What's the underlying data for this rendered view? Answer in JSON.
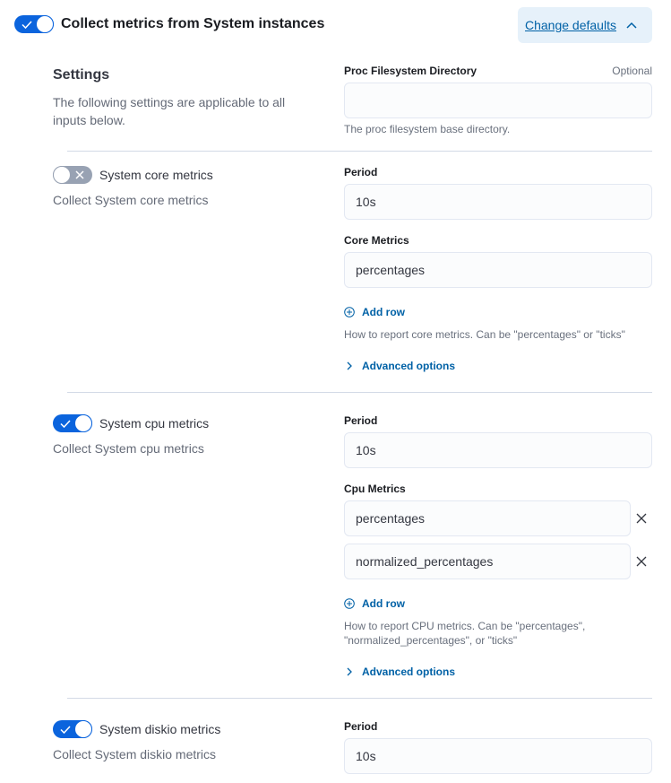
{
  "header": {
    "toggle_on": true,
    "title": "Collect metrics from System instances",
    "change_defaults_label": "Change defaults",
    "change_defaults_icon": "chevron-up-icon"
  },
  "settings": {
    "title": "Settings",
    "description": "The following settings are applicable to all inputs below.",
    "proc_fs": {
      "label": "Proc Filesystem Directory",
      "optional_label": "Optional",
      "value": "",
      "help": "The proc filesystem base directory."
    }
  },
  "inputs": [
    {
      "title": "System core metrics",
      "description": "Collect System core metrics",
      "enabled": false,
      "period_label": "Period",
      "period_value": "10s",
      "metrics_label": "Core Metrics",
      "metrics_values": [
        "percentages"
      ],
      "add_row_label": "Add row",
      "help": "How to report core metrics. Can be \"percentages\" or \"ticks\"",
      "advanced_label": "Advanced options"
    },
    {
      "title": "System cpu metrics",
      "description": "Collect System cpu metrics",
      "enabled": true,
      "period_label": "Period",
      "period_value": "10s",
      "metrics_label": "Cpu Metrics",
      "metrics_values": [
        "percentages",
        "normalized_percentages"
      ],
      "add_row_label": "Add row",
      "help_line1": "How to report CPU metrics. Can be \"percentages\",",
      "help_line2": "\"normalized_percentages\", or \"ticks\"",
      "advanced_label": "Advanced options"
    },
    {
      "title": "System diskio metrics",
      "description": "Collect System diskio metrics",
      "enabled": true,
      "period_label": "Period",
      "period_value": "10s"
    }
  ],
  "colors": {
    "accent": "#0b64dd",
    "link": "#0061a6",
    "switch_off": "#98a2b3"
  }
}
